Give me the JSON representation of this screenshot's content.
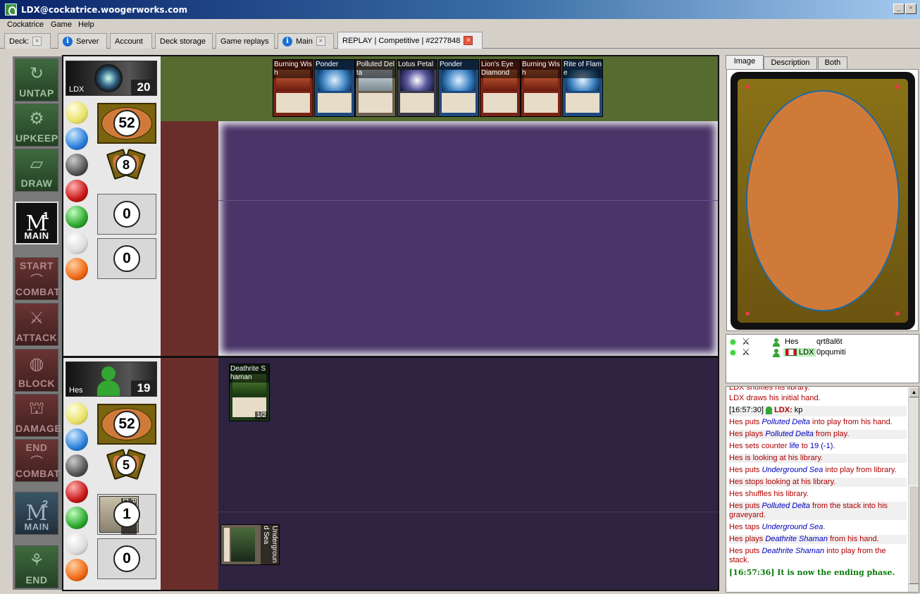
{
  "window": {
    "title": "LDX@cockatrice.woogerworks.com"
  },
  "menu": [
    "Cockatrice",
    "Game",
    "Help"
  ],
  "tabs": [
    {
      "label": "Deck:",
      "closable": true
    },
    {
      "label": "Server",
      "info": true
    },
    {
      "label": "Account"
    },
    {
      "label": "Deck storage"
    },
    {
      "label": "Game replays"
    },
    {
      "label": "Main",
      "info": true,
      "closable": true
    },
    {
      "label": "REPLAY | Competitive | #2277848",
      "closable": true,
      "active": true
    }
  ],
  "phases": [
    {
      "label": "UNTAP"
    },
    {
      "label": "UPKEEP"
    },
    {
      "label": "DRAW"
    },
    {
      "label": "MAIN",
      "number": "1",
      "active": true
    },
    {
      "label": "COMBAT",
      "top": "START"
    },
    {
      "label": "ATTACK"
    },
    {
      "label": "BLOCK"
    },
    {
      "label": "DAMAGE"
    },
    {
      "label": "COMBAT",
      "top": "END"
    },
    {
      "label": "MAIN",
      "number": "2"
    },
    {
      "label": "END"
    }
  ],
  "opponent": {
    "name": "LDX",
    "life": "20",
    "library": "52",
    "hand": "8",
    "graveyard": "0",
    "exile": "0"
  },
  "me": {
    "name": "Hes",
    "life": "19",
    "library": "52",
    "hand": "5",
    "graveyard": "1",
    "graveyard_top": "Polluted Delta",
    "exile": "0"
  },
  "stack_cards": [
    {
      "name": "Burning Wish",
      "color": "red"
    },
    {
      "name": "Ponder",
      "color": "blue"
    },
    {
      "name": "Polluted Delta",
      "color": "land"
    },
    {
      "name": "Lotus Petal",
      "color": "art"
    },
    {
      "name": "Ponder",
      "color": "blue"
    },
    {
      "name": "Lion's Eye Diamond",
      "color": "red"
    },
    {
      "name": "Burning Wish",
      "color": "red"
    },
    {
      "name": "Rite of Flame",
      "color": "red"
    }
  ],
  "my_battlefield": [
    {
      "name": "Deathrite Shaman",
      "pt": "1/2",
      "color": "green"
    },
    {
      "name": "Underground Sea",
      "color": "land",
      "tapped": true
    }
  ],
  "right_tabs": [
    "Image",
    "Description",
    "Both"
  ],
  "players_list": [
    {
      "name": "Hes",
      "deck": "qrt8al6t"
    },
    {
      "name": "LDX",
      "deck": "0pqumiti",
      "flag": "ca"
    }
  ],
  "chat": {
    "clipped": "LDX shuffles his library.",
    "draws": "LDX draws his initial hand.",
    "chat_ts": "[16:57:30]",
    "chat_speaker": "LDX:",
    "chat_text": "kp",
    "l1a": "Hes puts ",
    "l1b": "Polluted Delta",
    "l1c": " into play from his hand.",
    "l2a": "Hes plays ",
    "l2b": "Polluted Delta",
    "l2c": " from play.",
    "l3a": "Hes sets counter ",
    "l3b": "life",
    "l3c": " to ",
    "l3d": "19 (-1)",
    "l3e": ".",
    "l4": "Hes is looking at his library.",
    "l5a": "Hes puts ",
    "l5b": "Underground Sea",
    "l5c": " into play from library.",
    "l6": "Hes stops looking at his library.",
    "l7": "Hes shuffles his library.",
    "l8a": "Hes puts ",
    "l8b": "Polluted Delta",
    "l8c": " from the stack into his graveyard.",
    "l9a": "Hes taps ",
    "l9b": "Underground Sea",
    "l9c": ".",
    "l10a": "Hes plays ",
    "l10b": "Deathrite Shaman",
    "l10c": " from his hand.",
    "l11a": "Hes puts ",
    "l11b": "Deathrite Shaman",
    "l11c": " into play from the stack.",
    "phase_msg": "[16:57:36] It is now the ending phase."
  }
}
